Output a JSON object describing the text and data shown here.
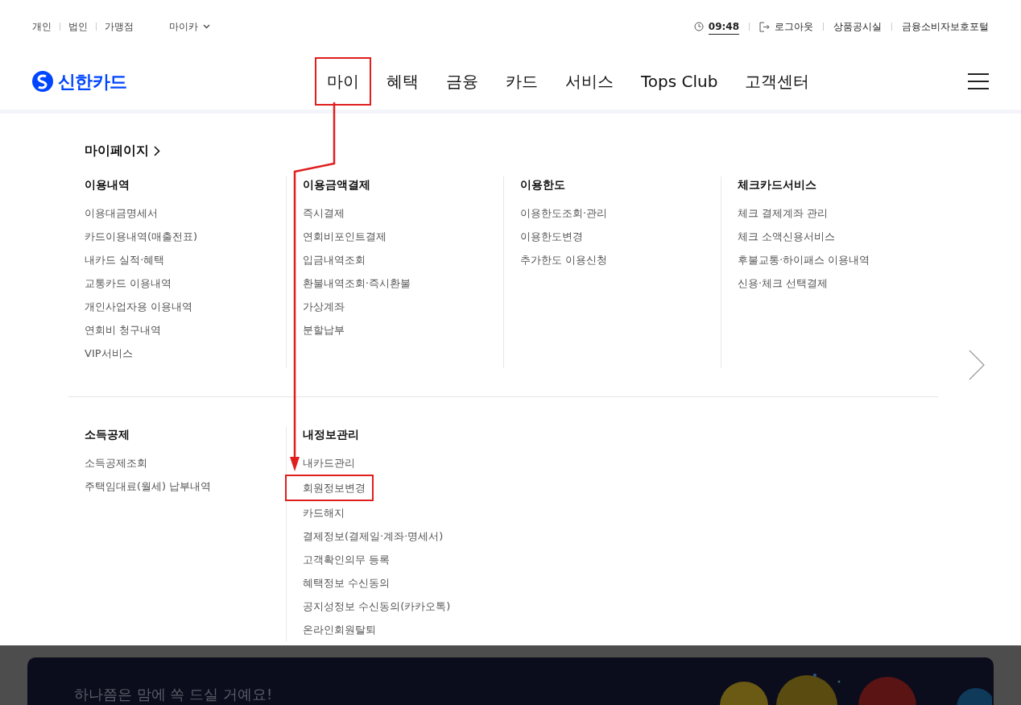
{
  "utility_bar": {
    "segments": [
      "개인",
      "법인",
      "가맹점"
    ],
    "dropdown": "마이카",
    "session_time": "09:48",
    "links": [
      {
        "kind": "logout",
        "label": "로그아웃"
      },
      {
        "kind": "plain",
        "label": "상품공시실"
      },
      {
        "kind": "plain",
        "label": "금융소비자보호포털"
      }
    ]
  },
  "logo": "신한카드",
  "nav": [
    {
      "label": "마이",
      "highlighted": true
    },
    {
      "label": "혜택",
      "highlighted": false
    },
    {
      "label": "금융",
      "highlighted": false
    },
    {
      "label": "카드",
      "highlighted": false
    },
    {
      "label": "서비스",
      "highlighted": false
    },
    {
      "label": "Tops Club",
      "highlighted": false
    },
    {
      "label": "고객센터",
      "highlighted": false
    }
  ],
  "mega_menu": {
    "title": "마이페이지",
    "rows": [
      [
        {
          "heading": "이용내역",
          "items": [
            {
              "label": "이용대금명세서",
              "highlighted": false
            },
            {
              "label": "카드이용내역(매출전표)",
              "highlighted": false
            },
            {
              "label": "내카드 실적·혜택",
              "highlighted": false
            },
            {
              "label": "교통카드 이용내역",
              "highlighted": false
            },
            {
              "label": "개인사업자용 이용내역",
              "highlighted": false
            },
            {
              "label": "연회비 청구내역",
              "highlighted": false
            },
            {
              "label": "VIP서비스",
              "highlighted": false
            }
          ]
        },
        {
          "heading": "이용금액결제",
          "items": [
            {
              "label": "즉시결제",
              "highlighted": false
            },
            {
              "label": "연회비포인트결제",
              "highlighted": false
            },
            {
              "label": "입금내역조회",
              "highlighted": false
            },
            {
              "label": "환불내역조회·즉시환불",
              "highlighted": false
            },
            {
              "label": "가상계좌",
              "highlighted": false
            },
            {
              "label": "분할납부",
              "highlighted": false
            }
          ]
        },
        {
          "heading": "이용한도",
          "items": [
            {
              "label": "이용한도조회·관리",
              "highlighted": false
            },
            {
              "label": "이용한도변경",
              "highlighted": false
            },
            {
              "label": "추가한도 이용신청",
              "highlighted": false
            }
          ]
        },
        {
          "heading": "체크카드서비스",
          "items": [
            {
              "label": "체크 결제계좌 관리",
              "highlighted": false
            },
            {
              "label": "체크 소액신용서비스",
              "highlighted": false
            },
            {
              "label": "후불교통·하이패스 이용내역",
              "highlighted": false
            },
            {
              "label": "신용·체크 선택결제",
              "highlighted": false
            }
          ]
        }
      ],
      [
        {
          "heading": "소득공제",
          "items": [
            {
              "label": "소득공제조회",
              "highlighted": false
            },
            {
              "label": "주택임대료(월세) 납부내역",
              "highlighted": false
            }
          ]
        },
        {
          "heading": "내정보관리",
          "items": [
            {
              "label": "내카드관리",
              "highlighted": false
            },
            {
              "label": "회원정보변경",
              "highlighted": true
            },
            {
              "label": "카드해지",
              "highlighted": false
            },
            {
              "label": "결제정보(결제일·계좌·명세서)",
              "highlighted": false
            },
            {
              "label": "고객확인의무 등록",
              "highlighted": false
            },
            {
              "label": "혜택정보 수신동의",
              "highlighted": false
            },
            {
              "label": "공지성정보 수신동의(카카오톡)",
              "highlighted": false
            },
            {
              "label": "온라인회원탈퇴",
              "highlighted": false
            }
          ]
        }
      ]
    ]
  },
  "banner": {
    "headline": "하나쯤은 맘에 쏙 드실 거예요!"
  }
}
